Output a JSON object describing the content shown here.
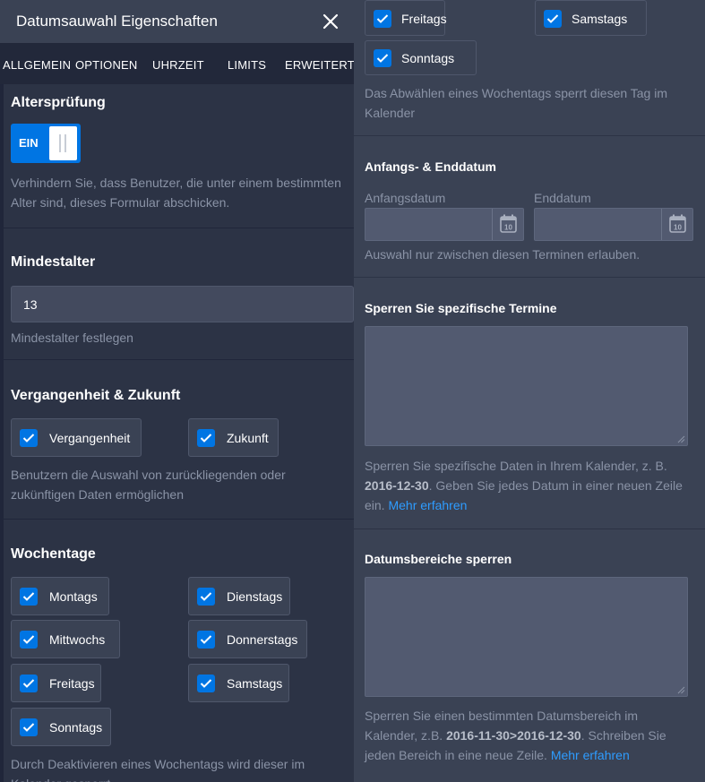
{
  "header": {
    "title": "Datumsauwahl Eigenschaften"
  },
  "tabs": [
    "ALLGEMEIN",
    "OPTIONEN",
    "UHRZEIT",
    "LIMITS",
    "ERWEITERT"
  ],
  "age_check": {
    "heading": "Altersprüfung",
    "toggle_label": "EIN",
    "help": [
      "Verhindern Sie, dass Benutzer, die unter einem bestimmten",
      "Alter sind, dieses Formular abschicken."
    ]
  },
  "min_age": {
    "heading": "Mindestalter",
    "value": "13",
    "help": "Mindestalter festlegen"
  },
  "past_future": {
    "heading": "Vergangenheit & Zukunft",
    "options": [
      "Vergangenheit",
      "Zukunft"
    ],
    "help": [
      "Benutzern die Auswahl von zurückliegenden oder",
      "zukünftigen Daten ermöglichen"
    ]
  },
  "weekdays_left": {
    "heading": "Wochentage",
    "options": [
      "Montags",
      "Dienstags",
      "Mittwochs",
      "Donnerstags",
      "Freitags",
      "Samstags",
      "Sonntags"
    ],
    "help": [
      "Durch Deaktivieren eines Wochentags wird dieser im",
      "Kalender gesperrt."
    ]
  },
  "weekdays_right": {
    "options": [
      "Freitags",
      "Samstags",
      "Sonntags"
    ],
    "help": [
      "Das Abwählen eines Wochentags sperrt diesen Tag im",
      "Kalender"
    ]
  },
  "date_range": {
    "heading": "Anfangs- & Enddatum",
    "start_label": "Anfangsdatum",
    "end_label": "Enddatum",
    "calendar_icon_text": "10",
    "help": "Auswahl nur zwischen diesen Terminen erlauben."
  },
  "block_dates": {
    "heading": "Sperren Sie spezifische Termine",
    "help_1": "Sperren Sie spezifische Daten in Ihrem Kalender, z. B.",
    "help_example": "2016-12-30",
    "help_2": ". Geben Sie jedes Datum in einer neuen Zeile",
    "help_3": "ein. ",
    "link": "Mehr erfahren"
  },
  "block_ranges": {
    "heading": "Datumsbereiche sperren",
    "help_1": "Sperren Sie einen bestimmten Datumsbereich im",
    "help_2": "Kalender, z.B. ",
    "help_example": "2016-11-30>2016-12-30",
    "help_3": ". Schreiben Sie",
    "help_4": "jeden Bereich in eine neue Zeile. ",
    "link": "Mehr erfahren"
  },
  "colors": {
    "accent": "#0075e3",
    "link": "#2e9cff",
    "panel": "#2c3345",
    "panel_right": "#3a4254"
  }
}
